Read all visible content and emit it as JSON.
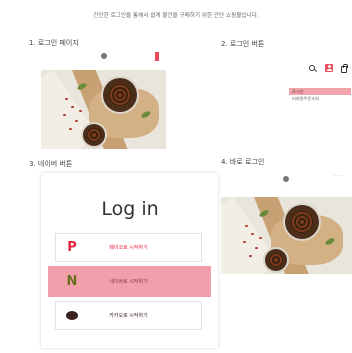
{
  "header": {
    "description": "간단한 로그인을 통해서 쉽게 물건을 구매하기 위한 간단 쇼핑몰입니다."
  },
  "sections": {
    "s1": {
      "title": "1. 로그인 페이지"
    },
    "s2": {
      "title": "2. 로그인 버튼"
    },
    "s3": {
      "title": "3. 네이버 버튼"
    },
    "s4": {
      "title": "4. 바로 로그인"
    }
  },
  "header_icons": [
    "search-icon",
    "user-icon",
    "bag-icon"
  ],
  "dropdown": {
    "items": [
      {
        "label": "로그인",
        "active": true
      },
      {
        "label": "비회원주문조회",
        "active": false
      }
    ]
  },
  "login_page": {
    "title": "Log in",
    "buttons": [
      {
        "icon_text": "P",
        "label": "페이코로 시작하기",
        "color": "#e8233b",
        "icon": "payco-icon"
      },
      {
        "icon_text": "N",
        "label": "네이버로 시작하기",
        "color": "#6b6a1f",
        "icon": "naver-icon",
        "highlighted": true
      },
      {
        "icon_text": "",
        "label": "카카오로 시작하기",
        "color": "#3b1e1e",
        "icon": "kakao-icon"
      }
    ]
  },
  "colors": {
    "accent": "#e8505f",
    "highlight": "#ef8f9c"
  }
}
